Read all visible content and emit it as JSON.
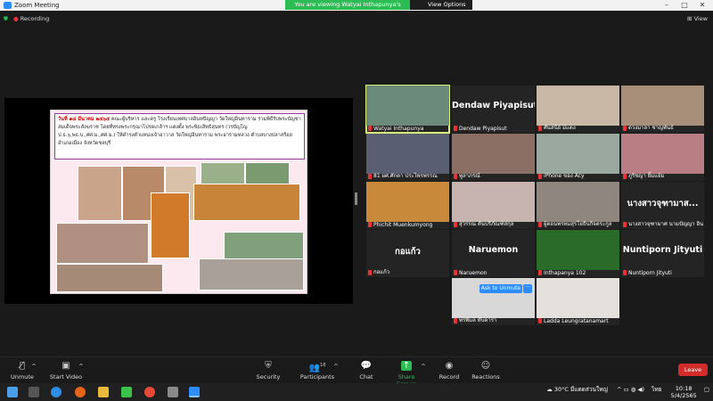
{
  "window": {
    "title": "Zoom Meeting",
    "banner": "You are viewing Watyai Inthapunya's screen",
    "view_options": "View Options"
  },
  "meeting": {
    "recording_label": "Recording",
    "view_label": "View"
  },
  "slide": {
    "date": "วันที่ ๑๘ มีนาคม ๒๕๖๕",
    "text": " คณะผู้บริหาร และครู โรงเรียนเทศบาลอินทปัญญา วัดใหญ่อินทาราม ร่วมพิธีรับพระบัญชาสมเด็จพระสังฆราช โดยที่ทรงพระกรุณาโปรดเกล้าฯ แต่งตั้ง พระพิธเสิทธิสุนทร (วรปัญโญ ป.ธ.๖,พธ.บ.,ศศ.ม.,ศศ.ม.) ให้ดำรงตำแหน่งเจ้าอาวาส วัดใหญ่อินทาราม พระอารามหลวง ตำบลบางปลาสร้อย อำเภอเมือง จังหวัดชลบุรี"
  },
  "participants": [
    {
      "name": "Watyai Inthapunya",
      "big": "",
      "video": true,
      "color": "#6b8a7a",
      "active": true
    },
    {
      "name": "Dendaw Piyapisut",
      "big": "Dendaw Piyapisut",
      "video": false,
      "color": "",
      "active": false
    },
    {
      "name": "ศันสนีย์ มีแตง",
      "big": "",
      "video": true,
      "color": "#c9b8a6",
      "active": false
    },
    {
      "name": "ดวงมาลา ชาญพันธ์",
      "big": "",
      "video": true,
      "color": "#a88f7a",
      "active": false
    },
    {
      "name": "81 ผศ.ศักดา ประไพรพรรณ",
      "big": "",
      "video": true,
      "color": "#5a5e72",
      "active": false
    },
    {
      "name": "พูลาภรณ์",
      "big": "",
      "video": true,
      "color": "#8c6f64",
      "active": false
    },
    {
      "name": "iPhone ของ Acy",
      "big": "",
      "video": true,
      "color": "#9aa8a0",
      "active": false
    },
    {
      "name": "ภูริชญา ยิ้มแย้ม",
      "big": "",
      "video": true,
      "color": "#b97e83",
      "active": false
    },
    {
      "name": "Phichit Muenkumyong",
      "big": "",
      "video": true,
      "color": "#c88a3a",
      "active": false
    },
    {
      "name": "สุวรรณ ตันบริภัณฑ์สกุล",
      "big": "",
      "video": true,
      "color": "#c7b4b0",
      "active": false
    },
    {
      "name": "ผู้ตอนพรหมสุรโยธินกิจตระกูล",
      "big": "",
      "video": true,
      "color": "#8f8680",
      "active": false
    },
    {
      "name": "นางสาวจุฑามาศ นามปัญญา อิน",
      "big": "นางสาวจุฑามาส...",
      "video": false,
      "color": "",
      "active": false
    },
    {
      "name": "กอแก้ว",
      "big": "กอแก้ว",
      "video": false,
      "color": "",
      "active": false
    },
    {
      "name": "Naruemon",
      "big": "Naruemon",
      "video": false,
      "color": "",
      "active": false
    },
    {
      "name": "Inthapanya 102",
      "big": "",
      "video": true,
      "color": "#2a6b2a",
      "active": false
    },
    {
      "name": "Nuntiporn Jityuti",
      "big": "Nuntiporn Jityuti",
      "video": false,
      "color": "",
      "active": false
    },
    {
      "name": "พรพิมล ทับดารา",
      "big": "",
      "video": true,
      "color": "#d8d8d8",
      "active": false
    },
    {
      "name": "Ladda Leungratanamart",
      "big": "",
      "video": true,
      "color": "#e4e0dc",
      "active": false
    }
  ],
  "ask_to_unmute": "Ask to Unmute",
  "toolbar": {
    "unmute": "Unmute",
    "start_video": "Start Video",
    "security": "Security",
    "participants": "Participants",
    "participants_count": "18",
    "chat": "Chat",
    "share_screen": "Share Screen",
    "record": "Record",
    "reactions": "Reactions",
    "leave": "Leave"
  },
  "taskbar": {
    "weather": "30°C มีแดดส่วนใหญ่",
    "lang": "ไทย",
    "time": "10:18",
    "date": "5/4/2565"
  }
}
